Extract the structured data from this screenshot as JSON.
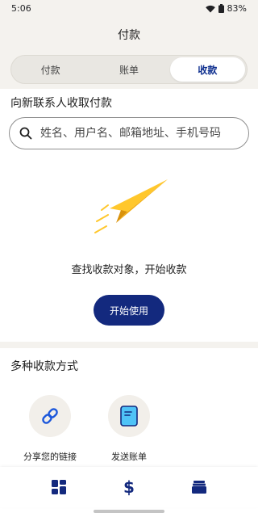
{
  "status": {
    "time": "5:06",
    "battery": "83%"
  },
  "header": {
    "title": "付款"
  },
  "tabs": [
    {
      "label": "付款",
      "active": false
    },
    {
      "label": "账单",
      "active": false
    },
    {
      "label": "收款",
      "active": true
    }
  ],
  "request": {
    "section_title": "向新联系人收取付款",
    "search_placeholder": "姓名、用户名、邮箱地址、手机号码",
    "empty_message": "查找收款对象，开始收款",
    "start_button": "开始使用"
  },
  "methods": {
    "section_title": "多种收款方式",
    "items": [
      {
        "label": "分享您的链接",
        "icon": "link-icon"
      },
      {
        "label": "发送账单",
        "icon": "invoice-icon"
      }
    ]
  },
  "bottom_nav": [
    {
      "icon": "dashboard-icon"
    },
    {
      "icon": "dollar-icon"
    },
    {
      "icon": "wallet-icon"
    }
  ],
  "colors": {
    "accent": "#13297e",
    "background": "#f4f2ee",
    "plane": "#ffc72c"
  }
}
